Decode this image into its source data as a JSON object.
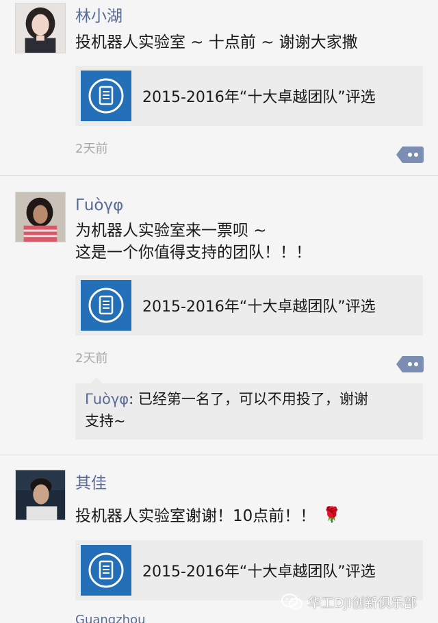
{
  "posts": [
    {
      "username": "林小湖",
      "content_lines": [
        "投机器人实验室 ~ 十点前 ~ 谢谢大家撒"
      ],
      "link_card": {
        "title": "2015-2016年“十大卓越团队”评选",
        "icon": "document-icon"
      },
      "timestamp": "2天前"
    },
    {
      "username": "Γuòγφ",
      "content_lines": [
        "为机器人实验室来一票呗 ~",
        "这是一个你值得支持的团队！！！"
      ],
      "link_card": {
        "title": "2015-2016年“十大卓越团队”评选",
        "icon": "document-icon"
      },
      "timestamp": "2天前",
      "reply": {
        "author": "Γuòγφ",
        "separator": ": ",
        "line1": "已经第一名了，可以不用投了，谢谢",
        "line2": "支持~"
      }
    },
    {
      "username": "其佳",
      "content_lines": [
        "投机器人实验室谢谢！10点前！！"
      ],
      "content_emoji": "rose-emoji",
      "link_card": {
        "title": "2015-2016年“十大卓越团队”评选",
        "icon": "document-icon"
      },
      "location": "Guangzhou"
    }
  ],
  "watermark": {
    "text": "华工DJI创新俱乐部",
    "icon": "wechat-icon"
  },
  "colors": {
    "username": "#576b95",
    "timestamp": "#a9a9a9",
    "card_background": "#ececec",
    "card_thumb": "#2470b8",
    "page_background": "#f5f5f5"
  }
}
